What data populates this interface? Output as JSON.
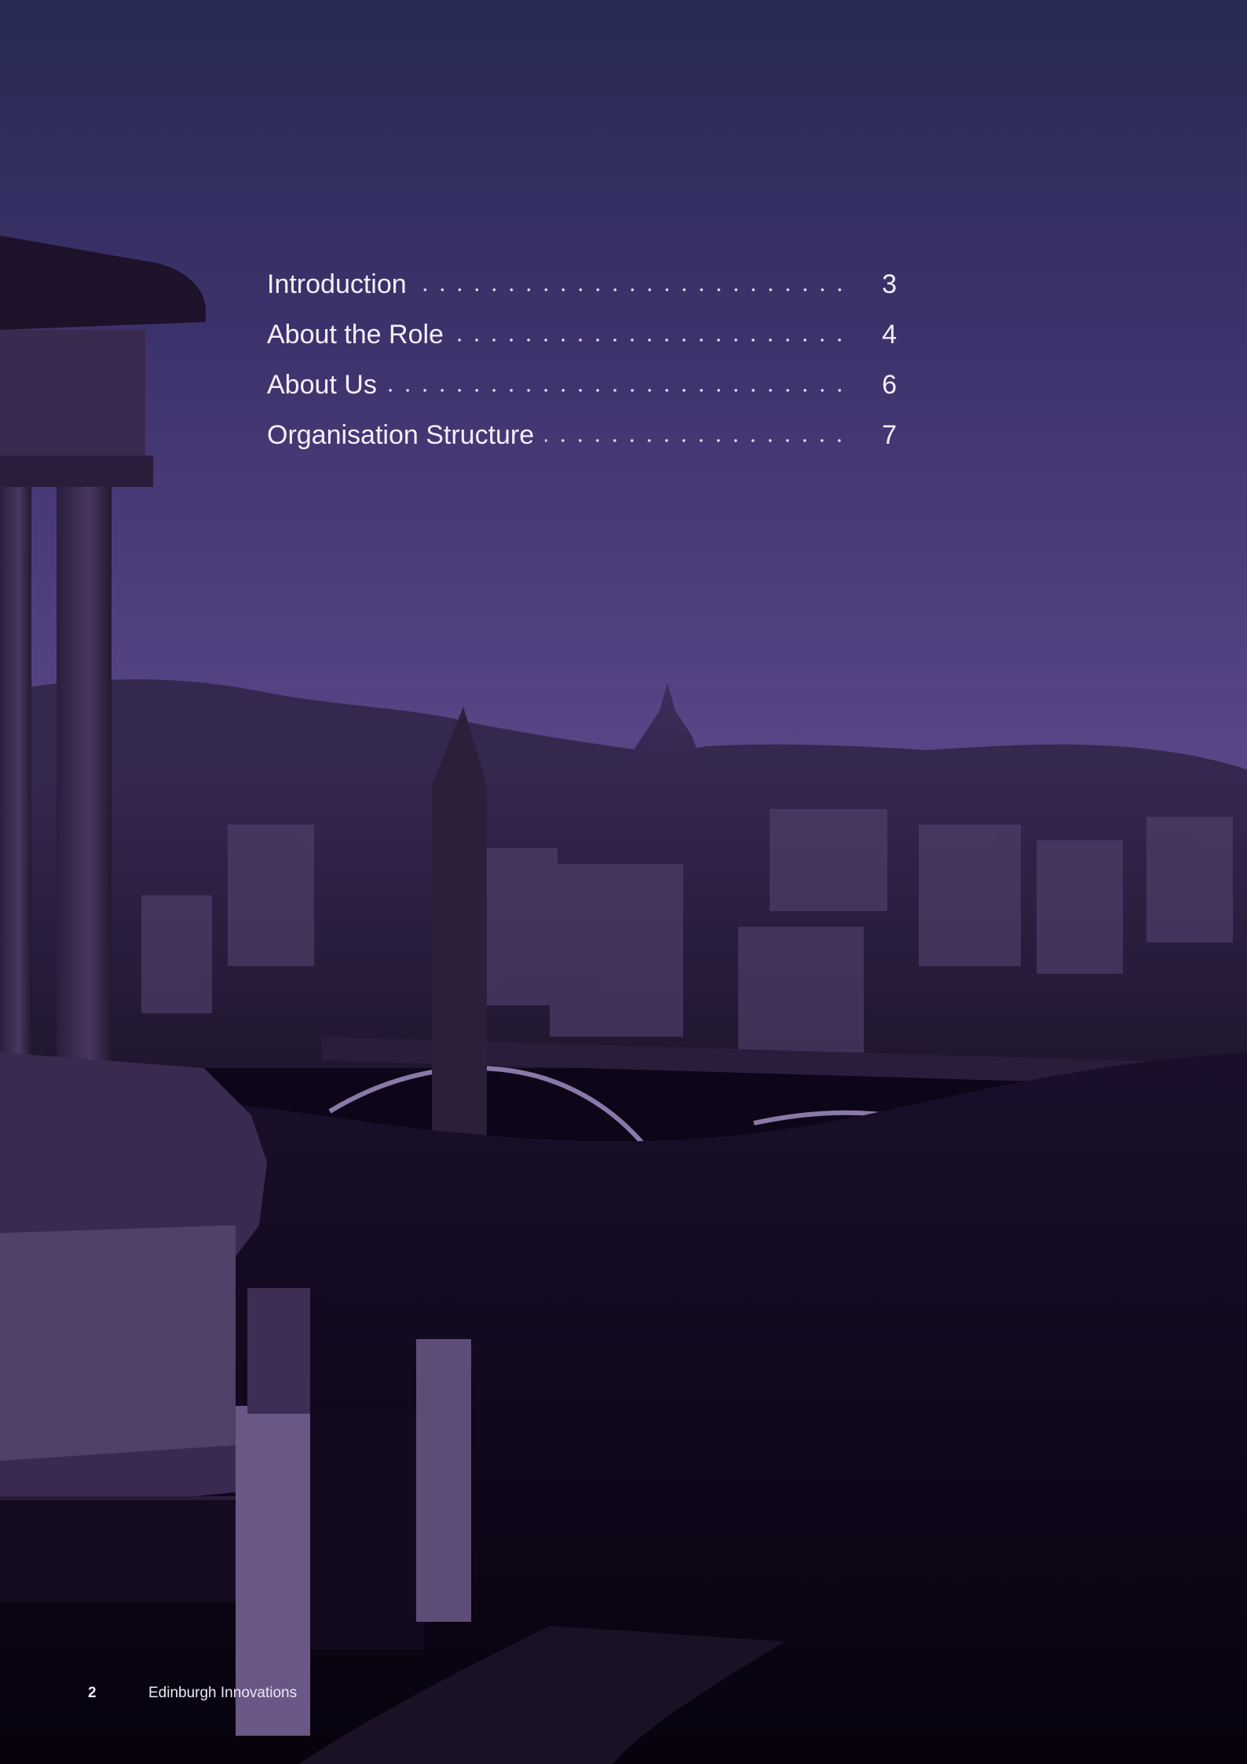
{
  "toc": {
    "entries": [
      {
        "title": "Introduction",
        "page": "3"
      },
      {
        "title": "About the Role",
        "page": "4"
      },
      {
        "title": "About Us",
        "page": "6"
      },
      {
        "title": "Organisation Structure",
        "page": "7"
      }
    ]
  },
  "footer": {
    "page_number": "2",
    "organisation": "Edinburgh Innovations"
  },
  "colors": {
    "sky_top": "#2a2a55",
    "sky_mid": "#4a3a78",
    "city": "#2e2245",
    "foreground": "#0b0414",
    "text": "#f3effa"
  },
  "background": {
    "type": "photo",
    "subject": "Edinburgh skyline at dusk seen from Calton Hill with purple tint"
  }
}
